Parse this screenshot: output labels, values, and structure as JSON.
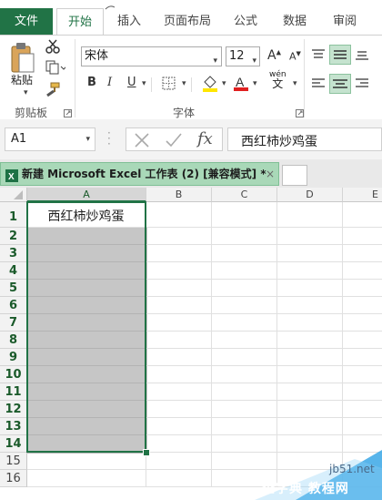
{
  "ribbon_tabs": {
    "file": "文件",
    "home": "开始",
    "insert": "插入",
    "page_layout": "页面布局",
    "formulas": "公式",
    "data": "数据",
    "review": "审阅"
  },
  "clipboard": {
    "paste_label": "粘贴",
    "group_label": "剪贴板"
  },
  "font": {
    "family": "宋体",
    "size": "12",
    "group_label": "字体",
    "bold": "B",
    "italic": "I",
    "underline": "U",
    "grow": "A",
    "shrink": "A",
    "wen_label": "wén",
    "wen_char": "文"
  },
  "name_box": "A1",
  "formula_fx": "fx",
  "formula_value": "西红柿炒鸡蛋",
  "document_tab": {
    "title": "新建 Microsoft Excel 工作表 (2)  [兼容模式] *",
    "close": "×"
  },
  "columns": [
    "A",
    "B",
    "C",
    "D",
    "E"
  ],
  "rows": [
    "1",
    "2",
    "3",
    "4",
    "5",
    "6",
    "7",
    "8",
    "9",
    "10",
    "11",
    "12",
    "13",
    "14",
    "15",
    "16"
  ],
  "cells": {
    "A1": "西红柿炒鸡蛋"
  },
  "selection": "A1:A14",
  "watermark": {
    "line1": "jb51.net",
    "line2": "查字典 教程网"
  }
}
